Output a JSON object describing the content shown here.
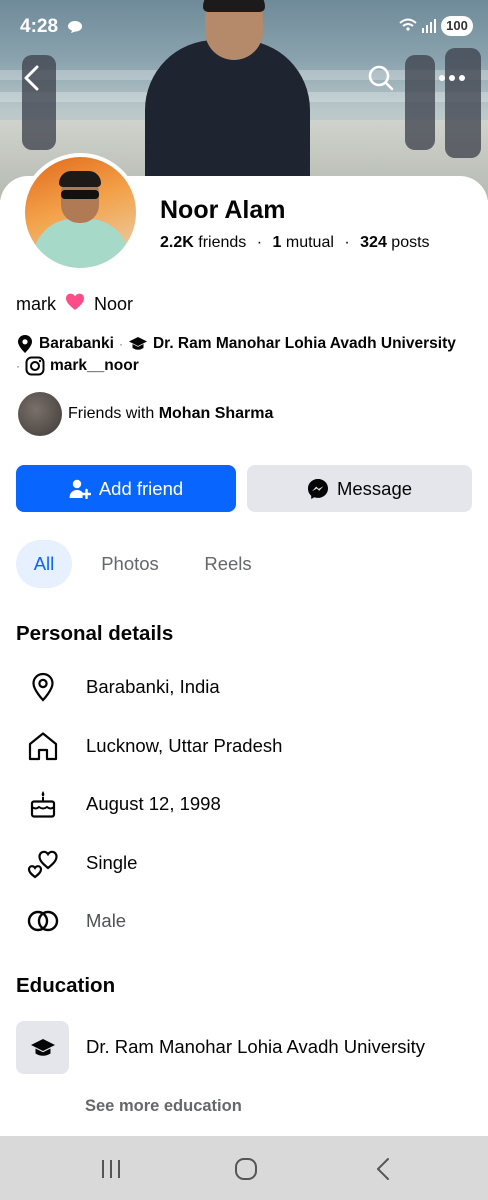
{
  "status_bar": {
    "time": "4:28",
    "battery": "100"
  },
  "profile": {
    "name": "Noor Alam",
    "friends_count": "2.2K",
    "friends_label": "friends",
    "mutual_count": "1",
    "mutual_label": "mutual",
    "posts_count": "324",
    "posts_label": "posts",
    "bio_left": "mark",
    "bio_right": "Noor",
    "location": "Barabanki",
    "education_short": "Dr. Ram Manohar Lohia Avadh University",
    "instagram": "mark__noor",
    "mutual_prefix": "Friends with",
    "mutual_friend": "Mohan Sharma"
  },
  "actions": {
    "add_friend": "Add friend",
    "message": "Message"
  },
  "tabs": [
    "All",
    "Photos",
    "Reels"
  ],
  "personal_details": {
    "title": "Personal details",
    "items": [
      {
        "icon": "location-pin-icon",
        "text": "Barabanki, India"
      },
      {
        "icon": "home-icon",
        "text": "Lucknow, Uttar Pradesh"
      },
      {
        "icon": "birthday-cake-icon",
        "text": "August 12, 1998"
      },
      {
        "icon": "hearts-icon",
        "text": "Single"
      },
      {
        "icon": "gender-rings-icon",
        "text": "Male"
      }
    ]
  },
  "education": {
    "title": "Education",
    "school": "Dr. Ram Manohar Lohia Avadh University",
    "see_more": "See more education"
  },
  "colors": {
    "primary": "#0866ff",
    "secondary_button": "#e4e6eb",
    "muted_text": "#65676b",
    "heart": "#ff4d8a"
  }
}
